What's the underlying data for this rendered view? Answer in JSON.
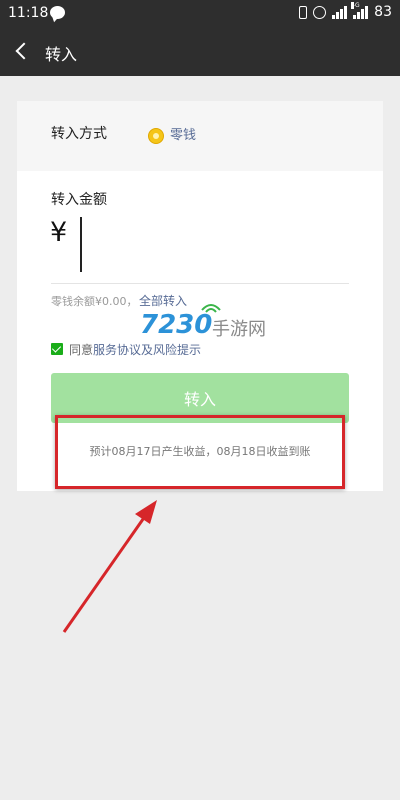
{
  "status_bar": {
    "time": "11:18",
    "network_label": "4G",
    "battery": "83"
  },
  "nav": {
    "title": "转入"
  },
  "card": {
    "method_label": "转入方式",
    "method_value": "零钱",
    "amount_label": "转入金额",
    "currency_symbol": "¥",
    "amount_value": "",
    "balance_text": "零钱余额¥0.00，",
    "withdraw_all": "全部转入",
    "agree_prefix": "同意",
    "agree_link": "服务协议及风险提示",
    "agree_checked": true,
    "submit_label": "转入",
    "forecast_text": "预计08月17日产生收益，08月18日收益到账"
  },
  "watermark": {
    "number": "7230",
    "text": "手游网"
  },
  "colors": {
    "header_bg": "#2e2e2e",
    "accent_green": "#1aad19",
    "button_disabled": "#a2e19f",
    "link_blue": "#576b95",
    "annotation_red": "#d6262a"
  }
}
